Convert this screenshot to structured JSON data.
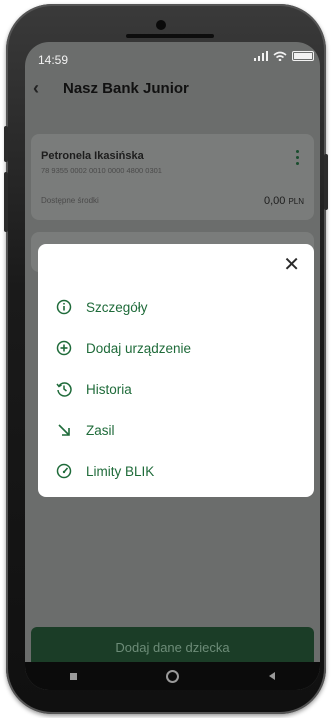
{
  "status_bar": {
    "time": "14:59"
  },
  "header": {
    "title": "Nasz Bank Junior"
  },
  "account": {
    "name": "Petronela Ikasińska",
    "number": "78 9355 0002 0010 0000 4800 0301",
    "available_label": "Dostępne środki",
    "amount": "0,00",
    "currency": "PLN"
  },
  "modal": {
    "items": [
      {
        "label": "Szczegóły",
        "icon": "info-circle-icon"
      },
      {
        "label": "Dodaj urządzenie",
        "icon": "plus-circle-icon"
      },
      {
        "label": "Historia",
        "icon": "history-icon"
      },
      {
        "label": "Zasil",
        "icon": "arrow-down-right-icon"
      },
      {
        "label": "Limity BLIK",
        "icon": "gauge-icon"
      }
    ]
  },
  "bottom_button": {
    "label": "Dodaj dane dziecka"
  },
  "colors": {
    "accent_green": "#1f6b3a",
    "button_dark_green": "#1b3d27"
  }
}
